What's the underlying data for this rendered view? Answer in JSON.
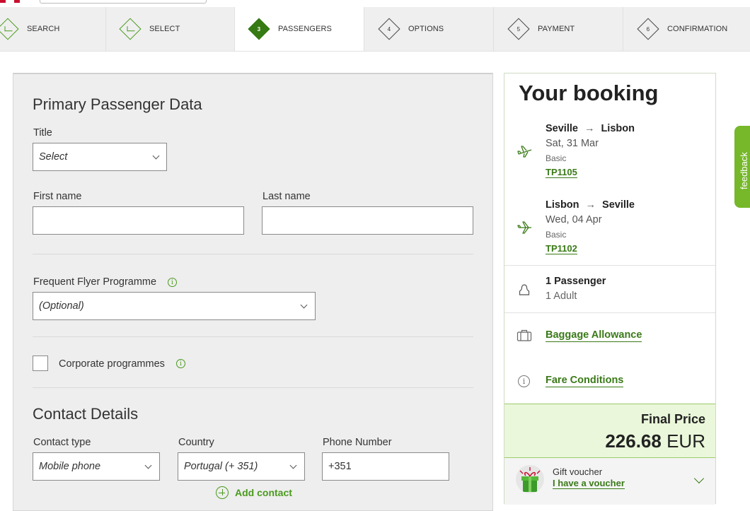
{
  "stepper": {
    "steps": [
      {
        "number": "",
        "label": "SEARCH",
        "state": "done"
      },
      {
        "number": "",
        "label": "SELECT",
        "state": "done"
      },
      {
        "number": "3",
        "label": "PASSENGERS",
        "state": "active"
      },
      {
        "number": "4",
        "label": "OPTIONS",
        "state": "todo"
      },
      {
        "number": "5",
        "label": "PAYMENT",
        "state": "todo"
      },
      {
        "number": "6",
        "label": "CONFIRMATION",
        "state": "todo"
      }
    ]
  },
  "form": {
    "primary_title": "Primary Passenger Data",
    "title_label": "Title",
    "title_value": "Select",
    "first_name_label": "First name",
    "first_name_value": "",
    "last_name_label": "Last name",
    "last_name_value": "",
    "ffp_label": "Frequent Flyer Programme",
    "ffp_value": "(Optional)",
    "corporate_label": "Corporate programmes",
    "contact_title": "Contact Details",
    "contact_type_label": "Contact type",
    "contact_type_value": "Mobile phone",
    "country_label": "Country",
    "country_value": "Portugal (+ 351)",
    "phone_label": "Phone Number",
    "phone_value": "+351",
    "add_contact": "Add contact"
  },
  "booking": {
    "title": "Your booking",
    "flights": [
      {
        "from": "Seville",
        "to": "Lisbon",
        "date": "Sat, 31 Mar",
        "class": "Basic",
        "flight": "TP1105"
      },
      {
        "from": "Lisbon",
        "to": "Seville",
        "date": "Wed, 04 Apr",
        "class": "Basic",
        "flight": "TP1102"
      }
    ],
    "passengers_title": "1 Passenger",
    "passengers_sub": "1 Adult",
    "baggage": "Baggage Allowance",
    "fare": "Fare Conditions",
    "final_price_label": "Final Price",
    "price_amount": "226.68",
    "price_currency": "EUR",
    "voucher_title": "Gift voucher",
    "voucher_link": "I have a voucher"
  },
  "feedback": {
    "label": "feedback"
  },
  "colors": {
    "accent": "#4a9a1e",
    "accent_dark": "#357a13",
    "price_bg": "#eaf7da",
    "feedback": "#76b82a"
  }
}
